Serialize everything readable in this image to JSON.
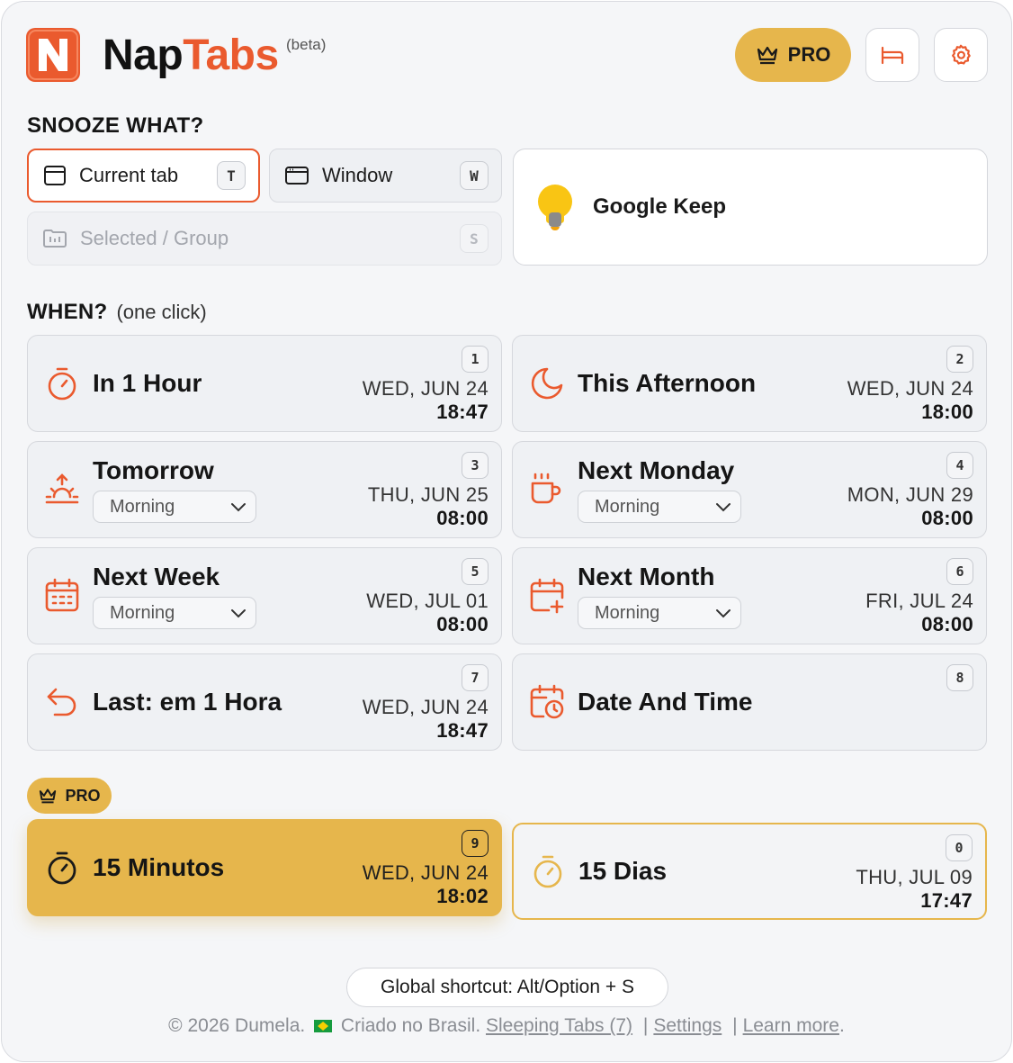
{
  "app": {
    "name_part1": "Nap",
    "name_part2": "Tabs",
    "beta": "(beta)"
  },
  "header": {
    "pro_label": "PRO"
  },
  "snooze": {
    "title": "SNOOZE WHAT?",
    "options": [
      {
        "label": "Current tab",
        "key": "T",
        "state": "active"
      },
      {
        "label": "Window",
        "key": "W",
        "state": "normal"
      },
      {
        "label": "Selected / Group",
        "key": "S",
        "state": "disabled"
      }
    ],
    "target": {
      "label": "Google Keep"
    }
  },
  "when": {
    "title": "WHEN?",
    "note": "(one click)",
    "cards": [
      {
        "title": "In 1 Hour",
        "num": "1",
        "date": "WED, JUN 24",
        "time": "18:47",
        "icon": "timer-icon"
      },
      {
        "title": "This Afternoon",
        "num": "2",
        "date": "WED, JUN 24",
        "time": "18:00",
        "icon": "moon-icon"
      },
      {
        "title": "Tomorrow",
        "num": "3",
        "date": "THU, JUN 25",
        "time": "08:00",
        "select": "Morning",
        "icon": "sunrise-icon"
      },
      {
        "title": "Next Monday",
        "num": "4",
        "date": "MON, JUN 29",
        "time": "08:00",
        "select": "Morning",
        "icon": "coffee-icon"
      },
      {
        "title": "Next Week",
        "num": "5",
        "date": "WED, JUL 01",
        "time": "08:00",
        "select": "Morning",
        "icon": "calendar-week-icon"
      },
      {
        "title": "Next Month",
        "num": "6",
        "date": "FRI, JUL 24",
        "time": "08:00",
        "select": "Morning",
        "icon": "calendar-plus-icon"
      },
      {
        "title": "Last: em 1 Hora",
        "num": "7",
        "date": "WED, JUN 24",
        "time": "18:47",
        "icon": "undo-icon"
      },
      {
        "title": "Date And Time",
        "num": "8",
        "icon": "calendar-clock-icon"
      }
    ]
  },
  "pro": {
    "chip": "PRO",
    "cards": [
      {
        "title": "15 Minutos",
        "num": "9",
        "date": "WED, JUN 24",
        "time": "18:02"
      },
      {
        "title": "15 Dias",
        "num": "0",
        "date": "THU, JUL 09",
        "time": "17:47"
      }
    ]
  },
  "shortcut": "Global shortcut: Alt/Option + S",
  "footer": {
    "copyright": "© 2026 Dumela.",
    "made_in": "Criado no Brasil.",
    "sleeping_tabs": "Sleeping Tabs (7)",
    "settings": "Settings",
    "learn_more": "Learn more",
    "sep": "|",
    "period": "."
  },
  "colors": {
    "accent": "#ea5a2e",
    "gold": "#e6b64c",
    "background": "#f5f6f8"
  }
}
